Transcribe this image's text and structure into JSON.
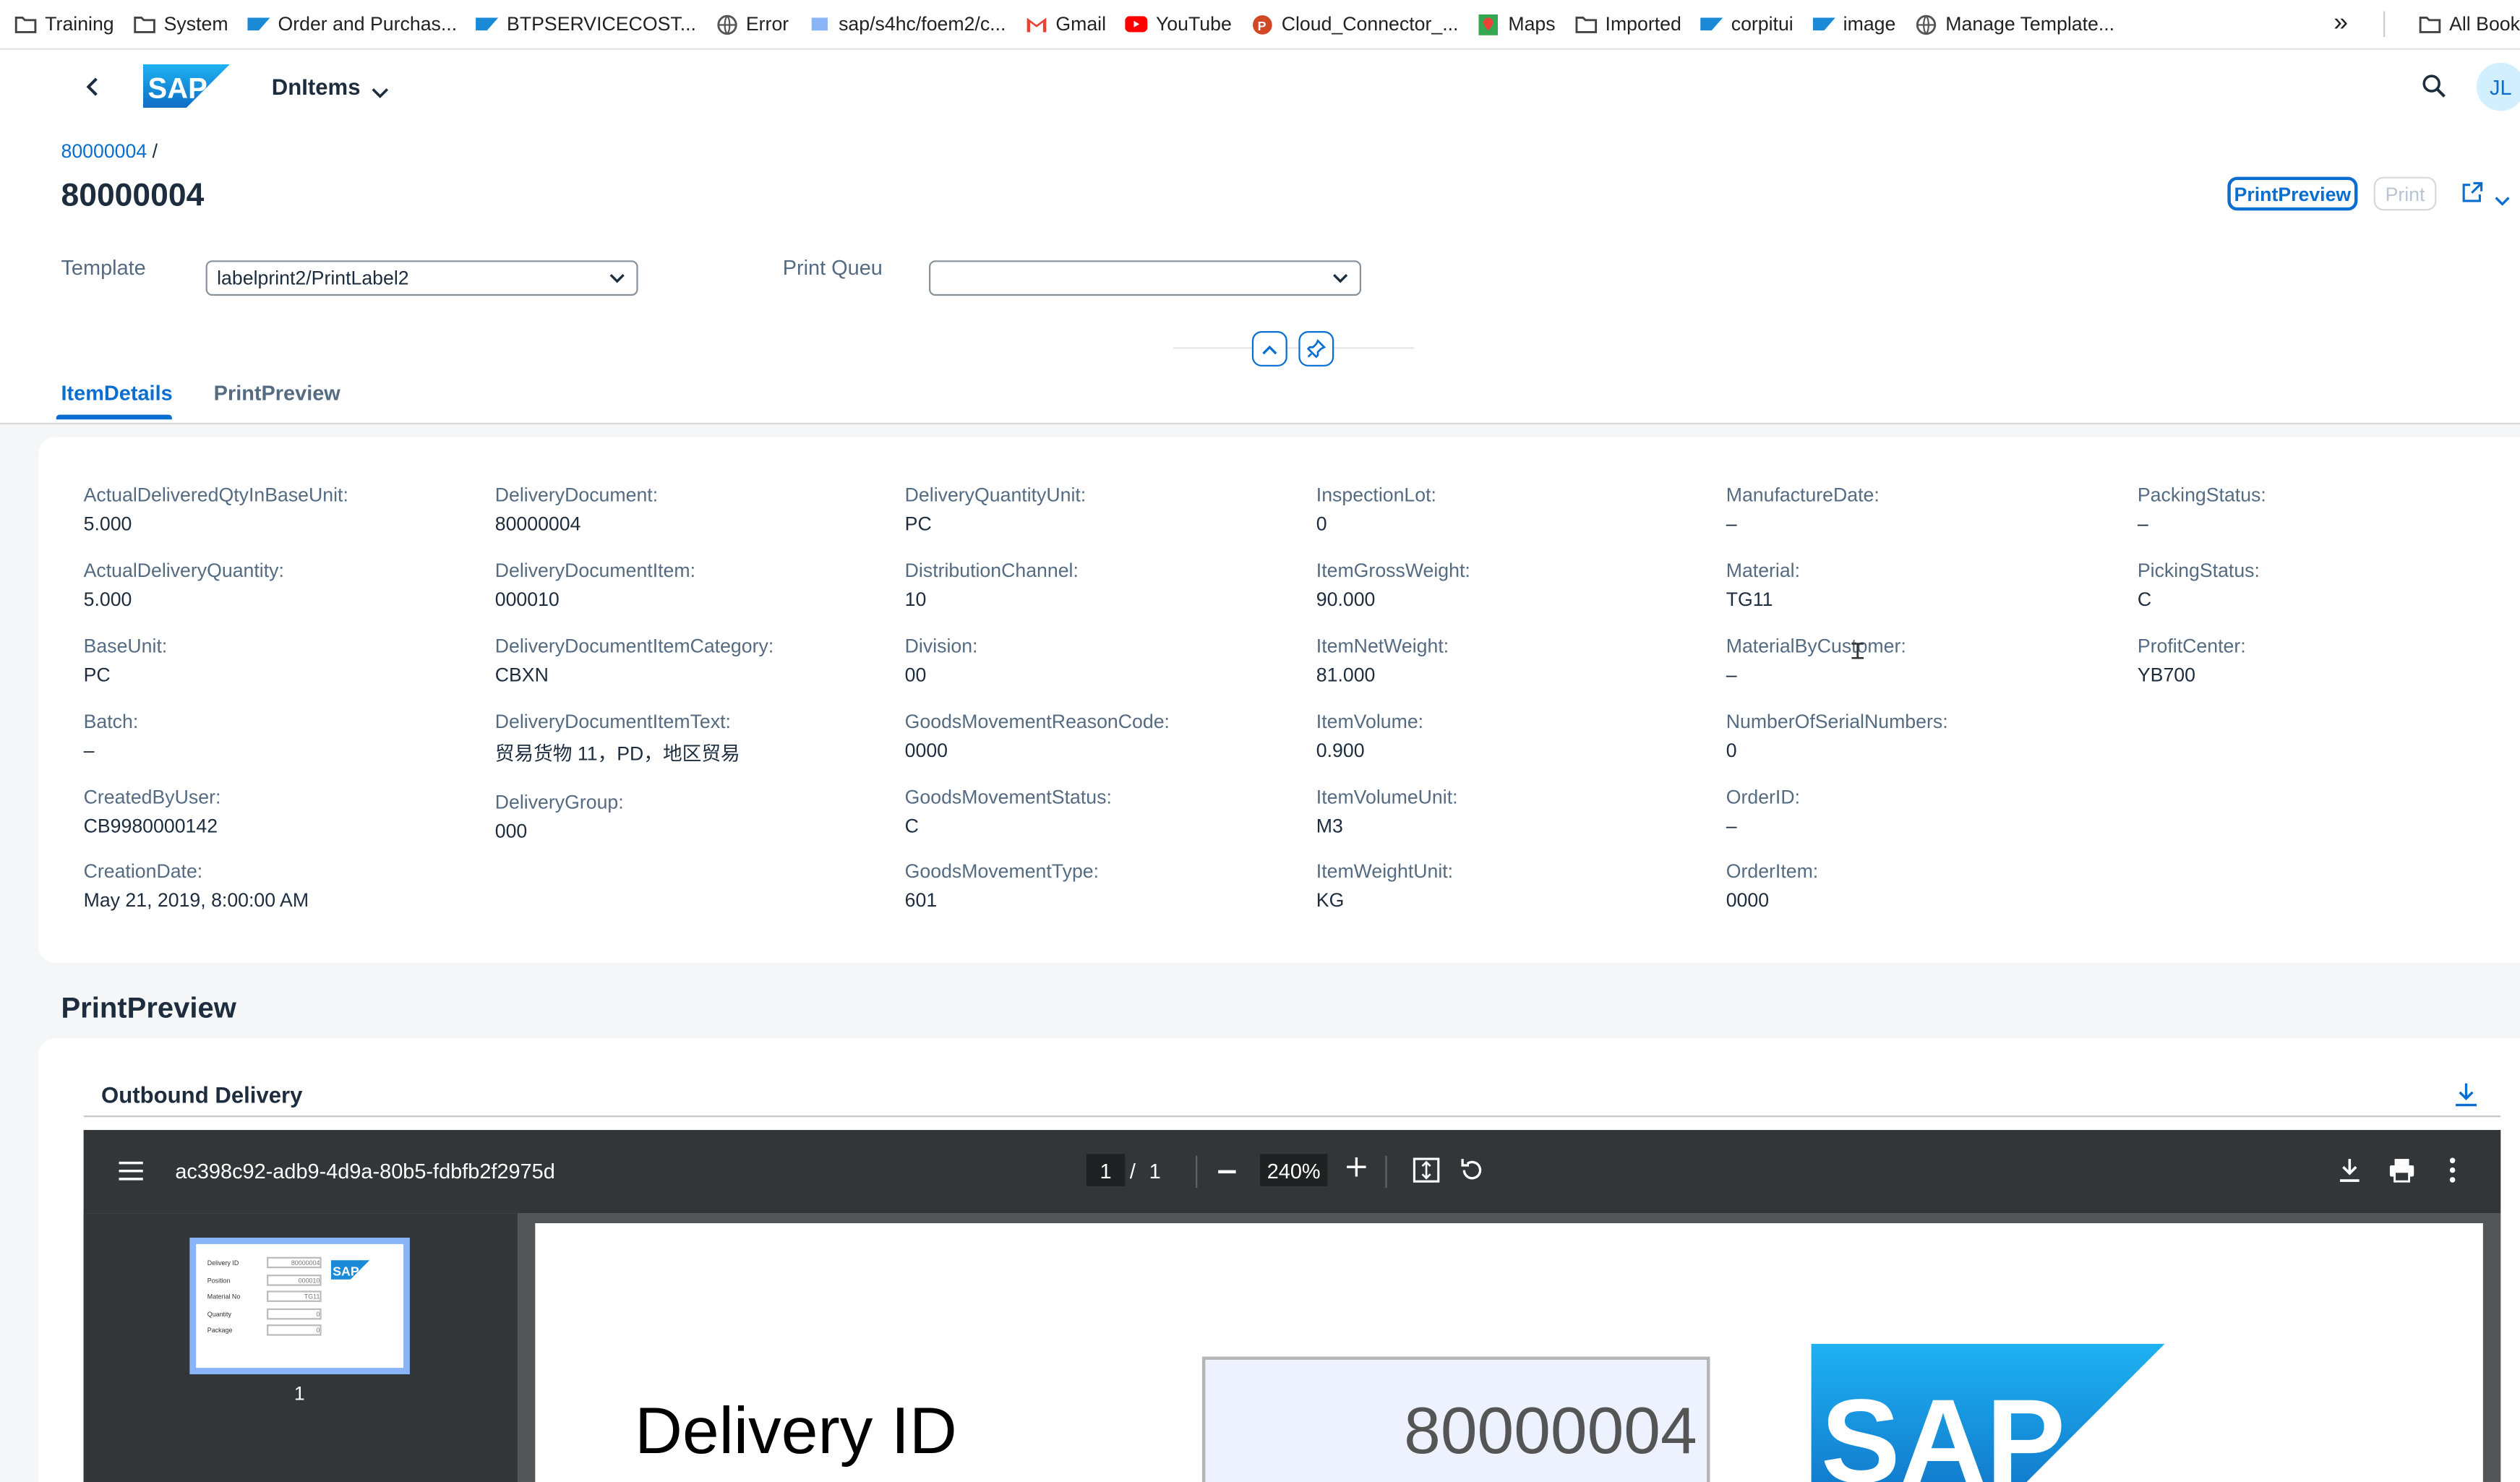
{
  "bookmarks": [
    {
      "label": "Training",
      "icon": "folder-icon"
    },
    {
      "label": "System",
      "icon": "folder-icon"
    },
    {
      "label": "Order and Purchas...",
      "icon": "sap-icon"
    },
    {
      "label": "BTPSERVICECOST...",
      "icon": "sap-icon"
    },
    {
      "label": "Error",
      "icon": "globe-icon"
    },
    {
      "label": "sap/s4hc/foem2/c...",
      "icon": "page-icon"
    },
    {
      "label": "Gmail",
      "icon": "gmail-icon"
    },
    {
      "label": "YouTube",
      "icon": "youtube-icon"
    },
    {
      "label": "Cloud_Connector_...",
      "icon": "powerpoint-icon"
    },
    {
      "label": "Maps",
      "icon": "maps-icon"
    },
    {
      "label": "Imported",
      "icon": "folder-icon"
    },
    {
      "label": "corpitui",
      "icon": "sap-icon"
    },
    {
      "label": "image",
      "icon": "sap-icon"
    },
    {
      "label": "Manage Template...",
      "icon": "globe-icon"
    }
  ],
  "bookmarks_more": "»",
  "all_bookmarks": "All Book",
  "shell": {
    "app_title": "DnItems",
    "avatar": "JL",
    "logo": "SAP"
  },
  "header": {
    "breadcrumb": "80000004",
    "breadcrumb_sep": "/",
    "title": "80000004",
    "print_preview_btn": "PrintPreview",
    "print_btn": "Print",
    "template_label": "Template",
    "template_value": "labelprint2/PrintLabel2",
    "queue_label": "Print Queu",
    "queue_value": ""
  },
  "tabs": [
    "ItemDetails",
    "PrintPreview"
  ],
  "fields": [
    [
      {
        "k": "ActualDeliveredQtyInBaseUnit:",
        "v": "5.000"
      },
      {
        "k": "ActualDeliveryQuantity:",
        "v": "5.000"
      },
      {
        "k": "BaseUnit:",
        "v": "PC"
      },
      {
        "k": "Batch:",
        "v": "–"
      },
      {
        "k": "CreatedByUser:",
        "v": "CB9980000142"
      },
      {
        "k": "CreationDate:",
        "v": "May 21, 2019, 8:00:00 AM"
      }
    ],
    [
      {
        "k": "DeliveryDocument:",
        "v": "80000004"
      },
      {
        "k": "DeliveryDocumentItem:",
        "v": "000010"
      },
      {
        "k": "DeliveryDocumentItemCategory:",
        "v": "CBXN"
      },
      {
        "k": "DeliveryDocumentItemText:",
        "v": "贸易货物 11，PD，地区贸易"
      },
      {
        "k": "DeliveryGroup:",
        "v": "000"
      }
    ],
    [
      {
        "k": "DeliveryQuantityUnit:",
        "v": "PC"
      },
      {
        "k": "DistributionChannel:",
        "v": "10"
      },
      {
        "k": "Division:",
        "v": "00"
      },
      {
        "k": "GoodsMovementReasonCode:",
        "v": "0000"
      },
      {
        "k": "GoodsMovementStatus:",
        "v": "C"
      },
      {
        "k": "GoodsMovementType:",
        "v": "601"
      }
    ],
    [
      {
        "k": "InspectionLot:",
        "v": "0"
      },
      {
        "k": "ItemGrossWeight:",
        "v": "90.000"
      },
      {
        "k": "ItemNetWeight:",
        "v": "81.000"
      },
      {
        "k": "ItemVolume:",
        "v": "0.900"
      },
      {
        "k": "ItemVolumeUnit:",
        "v": "M3"
      },
      {
        "k": "ItemWeightUnit:",
        "v": "KG"
      }
    ],
    [
      {
        "k": "ManufactureDate:",
        "v": "–"
      },
      {
        "k": "Material:",
        "v": "TG11"
      },
      {
        "k": "MaterialByCustomer:",
        "v": "–"
      },
      {
        "k": "NumberOfSerialNumbers:",
        "v": "0"
      },
      {
        "k": "OrderID:",
        "v": "–"
      },
      {
        "k": "OrderItem:",
        "v": "0000"
      }
    ],
    [
      {
        "k": "PackingStatus:",
        "v": "–"
      },
      {
        "k": "PickingStatus:",
        "v": "C"
      },
      {
        "k": "ProfitCenter:",
        "v": "YB700"
      }
    ]
  ],
  "preview": {
    "section_title": "PrintPreview",
    "panel_title": "Outbound Delivery",
    "file_name": "ac398c92-adb9-4d9a-80b5-fdbfb2f2975d",
    "page_current": "1",
    "page_sep": "/",
    "page_total": "1",
    "zoom": "240%",
    "thumb_page": "1",
    "thumb_labels": [
      "Delivery ID",
      "Position",
      "Material No",
      "Quantity",
      "Package"
    ],
    "thumb_values": [
      "80000004",
      "000010",
      "TG11",
      "0",
      "0"
    ],
    "doc_label": "Delivery ID",
    "doc_value": "80000004"
  },
  "colors": {
    "accent": "#0a6ed1",
    "shell_bg": "#ffffff",
    "pdf_toolbar": "#323639"
  }
}
